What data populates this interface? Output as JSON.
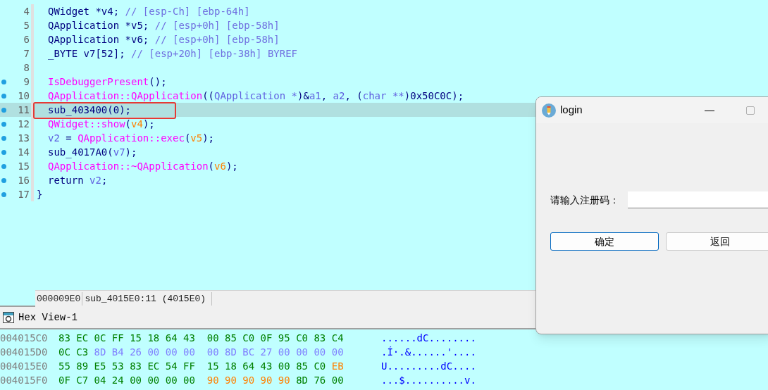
{
  "code": {
    "lines": [
      {
        "number": "4",
        "dot": false,
        "selected": false,
        "tokens": [
          {
            "text": "QWidget *v4; ",
            "kind": "plain"
          },
          {
            "text": "// [esp-Ch] [ebp-64h]",
            "kind": "comment"
          }
        ]
      },
      {
        "number": "5",
        "dot": false,
        "selected": false,
        "tokens": [
          {
            "text": "QApplication *v5; ",
            "kind": "plain"
          },
          {
            "text": "// [esp+0h] [ebp-58h]",
            "kind": "comment"
          }
        ]
      },
      {
        "number": "6",
        "dot": false,
        "selected": false,
        "tokens": [
          {
            "text": "QApplication *v6; ",
            "kind": "plain"
          },
          {
            "text": "// [esp+0h] [ebp-58h]",
            "kind": "comment"
          }
        ]
      },
      {
        "number": "7",
        "dot": false,
        "selected": false,
        "tokens": [
          {
            "text": "_BYTE v7[52]; ",
            "kind": "plain"
          },
          {
            "text": "// [esp+20h] [ebp-38h] BYREF",
            "kind": "comment"
          }
        ]
      },
      {
        "number": "8",
        "dot": false,
        "selected": false
      },
      {
        "number": "9",
        "dot": true,
        "selected": false,
        "tokens": [
          {
            "text": "IsDebuggerPresent",
            "kind": "func"
          },
          {
            "text": "();",
            "kind": "plain"
          }
        ]
      },
      {
        "number": "10",
        "dot": true,
        "selected": false,
        "tokens": [
          {
            "text": "QApplication::QApplication",
            "kind": "func"
          },
          {
            "text": "((",
            "kind": "plain"
          },
          {
            "text": "QApplication *",
            "kind": "var"
          },
          {
            "text": ")&",
            "kind": "plain"
          },
          {
            "text": "a1",
            "kind": "var"
          },
          {
            "text": ", ",
            "kind": "plain"
          },
          {
            "text": "a2",
            "kind": "var"
          },
          {
            "text": ", (",
            "kind": "plain"
          },
          {
            "text": "char **",
            "kind": "var"
          },
          {
            "text": ")0x50C0C);",
            "kind": "plain"
          }
        ]
      },
      {
        "number": "11",
        "dot": true,
        "selected": true,
        "tokens": [
          {
            "text": "sub_403400(0);",
            "kind": "plain"
          }
        ]
      },
      {
        "number": "12",
        "dot": true,
        "selected": false,
        "tokens": [
          {
            "text": "QWidget::show",
            "kind": "func"
          },
          {
            "text": "(",
            "kind": "plain"
          },
          {
            "text": "v4",
            "kind": "local"
          },
          {
            "text": ");",
            "kind": "plain"
          }
        ]
      },
      {
        "number": "13",
        "dot": true,
        "selected": false,
        "tokens": [
          {
            "text": "v2",
            "kind": "var"
          },
          {
            "text": " = ",
            "kind": "plain"
          },
          {
            "text": "QApplication::exec",
            "kind": "func"
          },
          {
            "text": "(",
            "kind": "plain"
          },
          {
            "text": "v5",
            "kind": "local"
          },
          {
            "text": ");",
            "kind": "plain"
          }
        ]
      },
      {
        "number": "14",
        "dot": true,
        "selected": false,
        "tokens": [
          {
            "text": "sub_4017A0(",
            "kind": "plain"
          },
          {
            "text": "v7",
            "kind": "var"
          },
          {
            "text": ");",
            "kind": "plain"
          }
        ]
      },
      {
        "number": "15",
        "dot": true,
        "selected": false,
        "tokens": [
          {
            "text": "QApplication::~QApplication",
            "kind": "func"
          },
          {
            "text": "(",
            "kind": "plain"
          },
          {
            "text": "v6",
            "kind": "local"
          },
          {
            "text": ");",
            "kind": "plain"
          }
        ]
      },
      {
        "number": "16",
        "dot": true,
        "selected": false,
        "tokens": [
          {
            "text": "return ",
            "kind": "plain"
          },
          {
            "text": "v2",
            "kind": "var"
          },
          {
            "text": ";",
            "kind": "plain"
          }
        ]
      },
      {
        "number": "17",
        "dot": true,
        "selected": false,
        "tokens": [
          {
            "text": "}",
            "kind": "plain"
          }
        ],
        "outdent": true
      }
    ]
  },
  "status_bar": {
    "offset": "000009E0",
    "location": "sub_4015E0:11 (4015E0)"
  },
  "hex_view": {
    "title": "Hex View-1",
    "rows": [
      {
        "address": "004015C0",
        "bytes": [
          {
            "text": "83 EC 0C FF 15 18 64 43  00 85 C0 0F 95 C0 83 C4",
            "kind": "code"
          }
        ],
        "ascii": "......dC........"
      },
      {
        "address": "004015D0",
        "bytes": [
          {
            "text": "0C C3 ",
            "kind": "code"
          },
          {
            "text": "8D B4 26 00 00 00  00 8D BC 27 00 00 00 00",
            "kind": "data"
          }
        ],
        "ascii": ".Í·.&......'...."
      },
      {
        "address": "004015E0",
        "bytes": [
          {
            "text": "55 89 E5 53 83 EC 54 FF  15 18 64 43 00 85 C0 ",
            "kind": "code"
          },
          {
            "text": "EB",
            "kind": "unexplored"
          }
        ],
        "ascii": "U.........dC...."
      },
      {
        "address": "004015F0",
        "bytes": [
          {
            "text": "0F C7 04 24 00 00 00 00  ",
            "kind": "code"
          },
          {
            "text": "90 90 90 90 90 ",
            "kind": "unexplored"
          },
          {
            "text": "8D 76 00",
            "kind": "code"
          }
        ],
        "ascii": "...$..........v."
      }
    ]
  },
  "login_window": {
    "title": "login",
    "minimize": "—",
    "label": "请输入注册码：",
    "buttons": [
      {
        "label": "确定",
        "focused": true
      },
      {
        "label": "返回",
        "focused": false
      }
    ]
  }
}
